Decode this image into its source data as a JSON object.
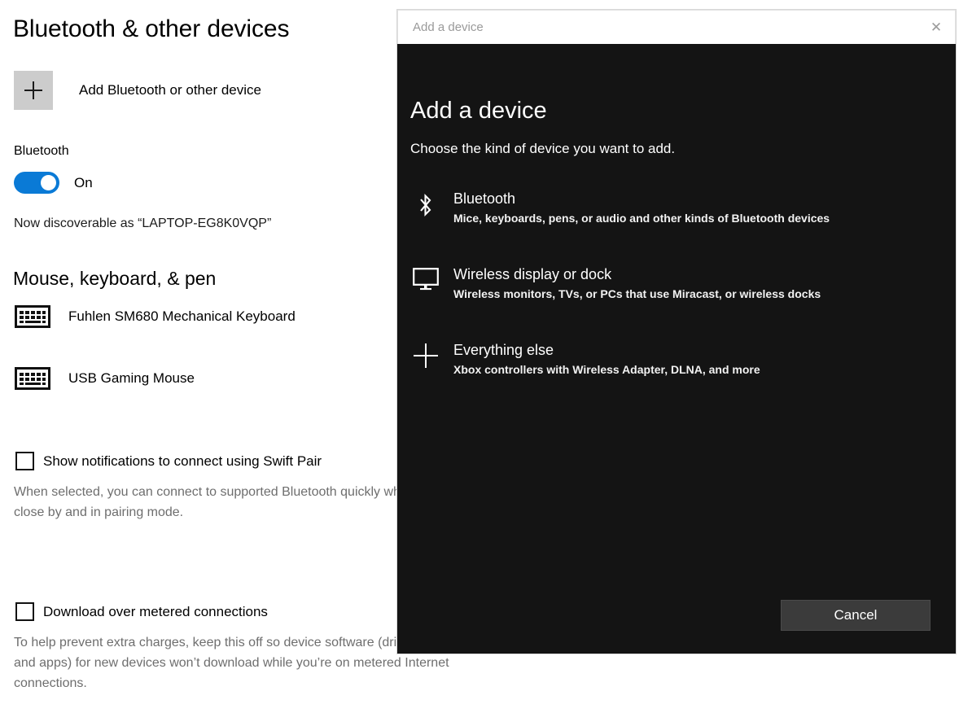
{
  "settings": {
    "page_title": "Bluetooth & other devices",
    "add_device": {
      "label": "Add Bluetooth or other device",
      "icon": "plus-icon"
    },
    "bluetooth": {
      "section_label": "Bluetooth",
      "toggle_state": "On",
      "discoverable": "Now discoverable as “LAPTOP-EG8K0VQP”"
    },
    "mouse_keyboard_pen": {
      "heading": "Mouse, keyboard, & pen",
      "devices": [
        {
          "name": "Fuhlen SM680 Mechanical Keyboard",
          "icon": "keyboard-icon"
        },
        {
          "name": "USB Gaming Mouse",
          "icon": "keyboard-icon"
        }
      ]
    },
    "options": [
      {
        "label": "Show notifications to connect using Swift Pair",
        "checked": false,
        "help": "When selected, you can connect to supported Bluetooth quickly when they're close by and in pairing mode."
      },
      {
        "label": "Download over metered connections",
        "checked": false,
        "help": "To help prevent extra charges, keep this off so device software (drivers, info, and apps) for new devices won’t download while you’re on metered Internet connections."
      }
    ]
  },
  "dialog": {
    "titlebar_text": "Add a device",
    "close_icon": "close-icon",
    "heading": "Add a device",
    "subheading": "Choose the kind of device you want to add.",
    "device_types": [
      {
        "title": "Bluetooth",
        "description": "Mice, keyboards, pens, or audio and other kinds of Bluetooth devices",
        "icon": "bluetooth-icon"
      },
      {
        "title": "Wireless display or dock",
        "description": "Wireless monitors, TVs, or PCs that use Miracast, or wireless docks",
        "icon": "monitor-icon"
      },
      {
        "title": "Everything else",
        "description": "Xbox controllers with Wireless Adapter, DLNA, and more",
        "icon": "plus-icon"
      }
    ],
    "cancel_label": "Cancel"
  },
  "colors": {
    "accent_blue": "#0a7ad6",
    "dialog_bg": "#141414",
    "tile_gray": "#cccccc",
    "help_text": "#6e6e6e"
  }
}
